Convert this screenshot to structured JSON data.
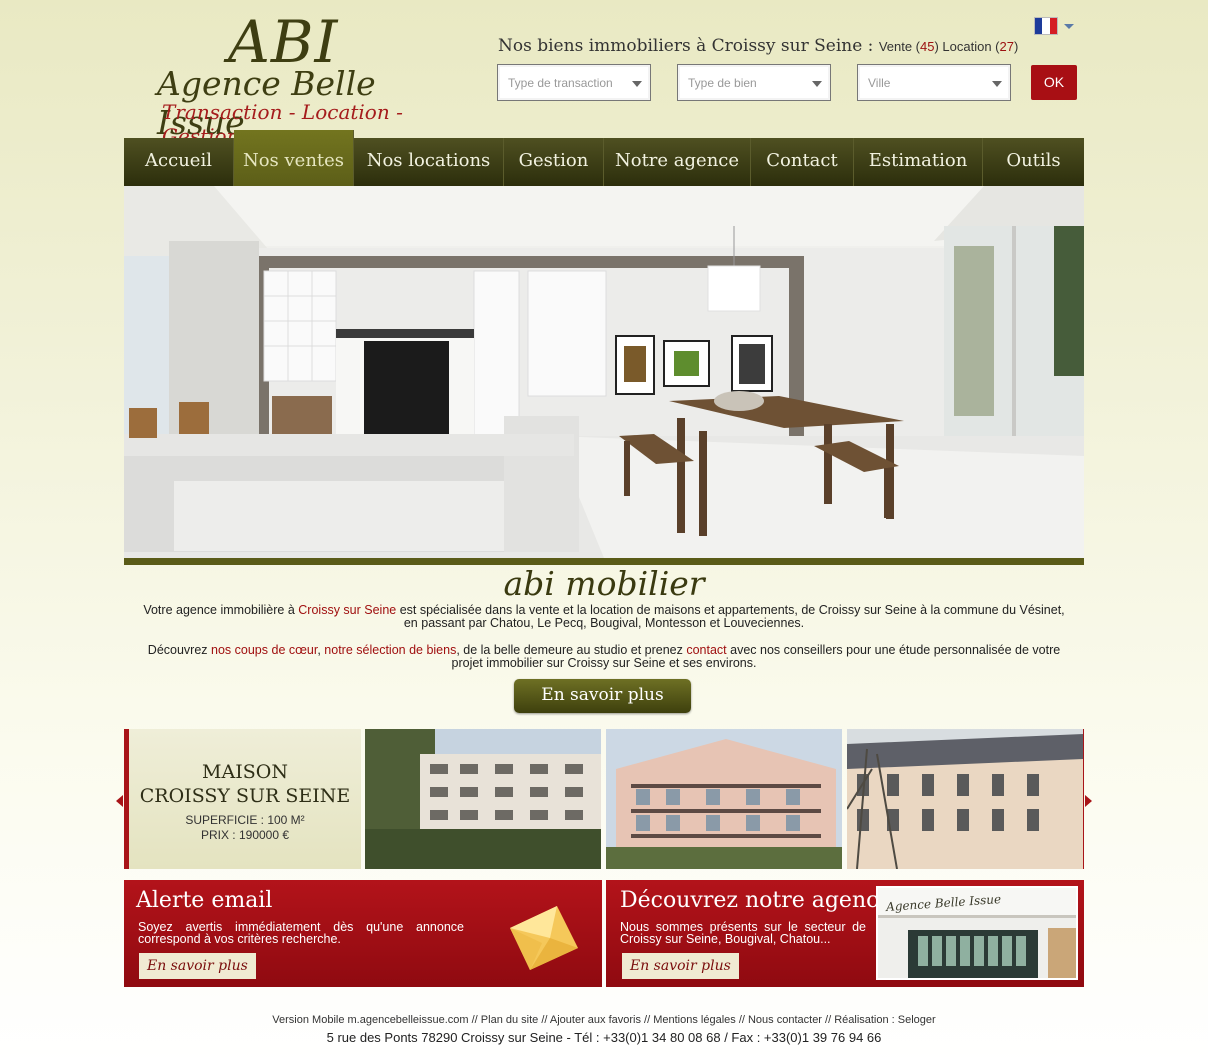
{
  "logo": {
    "big": "ABI",
    "name": "Agence Belle Issue",
    "tagline": "Transaction - Location - Gestion"
  },
  "header": {
    "title": "Nos biens immobiliers à Croissy sur Seine :",
    "vente_label": "Vente (",
    "vente_count": "45",
    "location_label": ") Location (",
    "location_count": "27",
    "close_paren": ")"
  },
  "language": {
    "icon": "french-flag-icon",
    "colors": [
      "#1d3b9a",
      "#ffffff",
      "#d51d24"
    ]
  },
  "search": {
    "transaction_placeholder": "Type de transaction",
    "bien_placeholder": "Type de bien",
    "ville_placeholder": "Ville",
    "ok_label": "OK"
  },
  "nav": {
    "items": [
      {
        "label": "Accueil"
      },
      {
        "label": "Nos ventes"
      },
      {
        "label": "Nos locations"
      },
      {
        "label": "Gestion"
      },
      {
        "label": "Notre agence"
      },
      {
        "label": "Contact"
      },
      {
        "label": "Estimation"
      },
      {
        "label": "Outils"
      }
    ],
    "active": "Nos ventes"
  },
  "intro": {
    "title": "abi mobilier",
    "p1_a": "Votre agence immobilière à ",
    "p1_link": "Croissy sur Seine",
    "p1_b": " est spécialisée dans la vente et la location de maisons et appartements, de Croissy sur Seine à la commune du Vésinet, en passant par Chatou, Le Pecq, Bougival, Montesson et Louveciennes.",
    "p2_a": "Découvrez ",
    "p2_link1": "nos coups de cœur",
    "p2_sep": ", ",
    "p2_link2": "notre sélection de biens",
    "p2_b": ", de la belle demeure au studio et prenez ",
    "p2_link3": "contact",
    "p2_c": " avec nos conseillers pour une étude personnalisée de votre projet immobilier sur Croissy sur Seine et ses environs.",
    "button": "En savoir plus"
  },
  "featured": {
    "type": "MAISON",
    "city": "CROISSY SUR SEINE",
    "surface": "SUPERFICIE : 100 M²",
    "price": "PRIX : 190000 €"
  },
  "promo_alert": {
    "title": "Alerte email",
    "text": "Soyez avertis immédiatement dès qu'une annonce correspond à vos critères recherche.",
    "button": "En savoir plus",
    "icon": "envelope-icon"
  },
  "promo_agency": {
    "title": "Découvrez notre agence",
    "text": "Nous sommes présents sur le secteur de Croissy sur Seine, Bougival, Chatou...",
    "button": "En savoir plus",
    "sign": "Agence Belle Issue"
  },
  "footer": {
    "links": "Version Mobile m.agencebelleissue.com //  Plan du site  //  Ajouter aux favoris  //  Mentions légales  //  Nous contacter  //  Réalisation : Seloger",
    "address": "5 rue des Ponts 78290 Croissy sur Seine - Tél : +33(0)1 34 80 08 68 / Fax : +33(0)1 39 76 94 66"
  },
  "colors": {
    "accent_red": "#a80f14",
    "nav_olive": "#3a3c12",
    "link_red": "#a01010"
  }
}
